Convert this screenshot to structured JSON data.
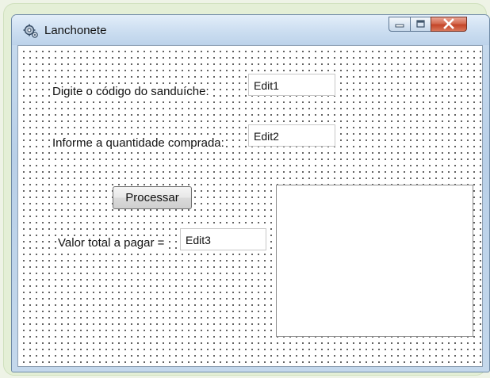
{
  "window": {
    "title": "Lanchonete",
    "app_icon": "gears-icon",
    "controls": [
      "minimize-icon",
      "maximize-icon",
      "close-icon"
    ]
  },
  "form": {
    "codigo_label": "Digite o código do sanduíche:",
    "codigo_value": "Edit1",
    "quantidade_label": "Informe a quantidade comprada:",
    "quantidade_value": "Edit2",
    "processar_button": "Processar",
    "total_label": "Valor total a pagar =",
    "total_value": "Edit3",
    "memo_value": ""
  }
}
